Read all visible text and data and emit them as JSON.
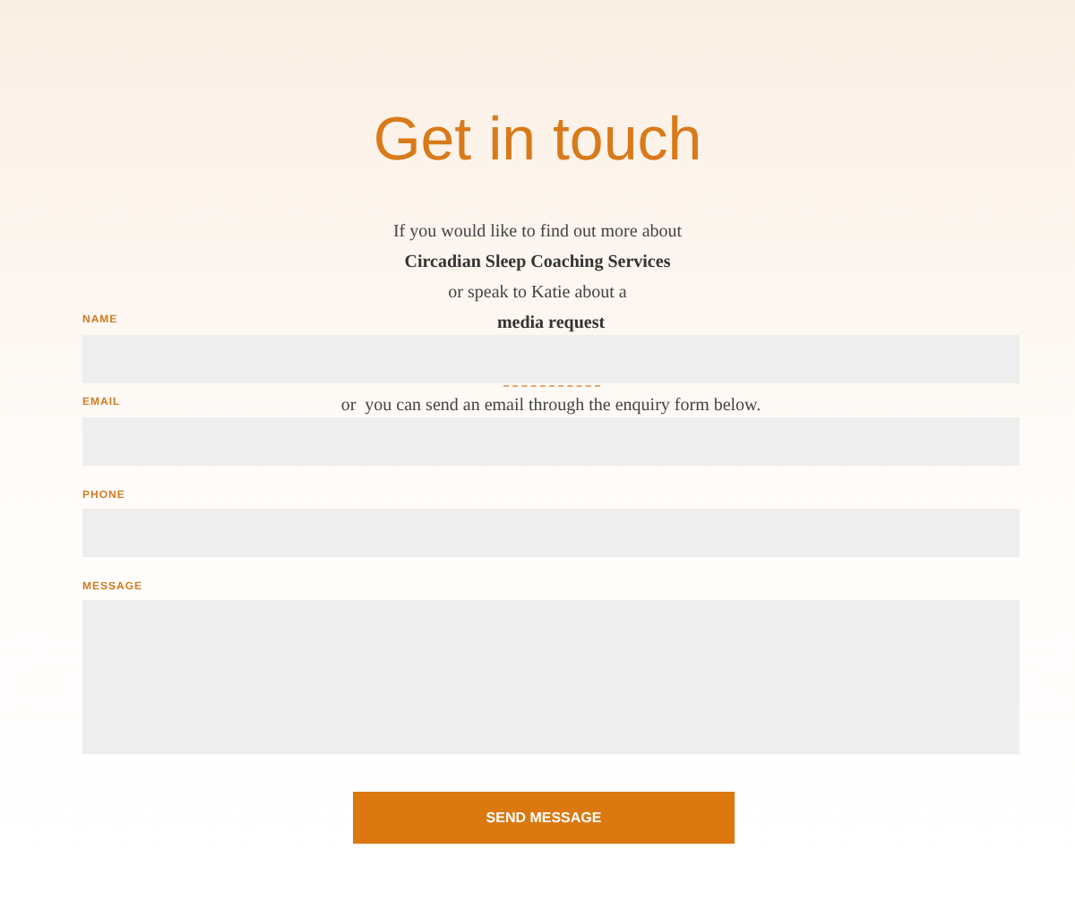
{
  "heading": "Get in touch",
  "intro": [
    {
      "text": "If you would like to find out more about",
      "bold": false
    },
    {
      "text": "Circadian Sleep Coaching Services",
      "bold": true
    },
    {
      "text": "or speak to Katie about a",
      "bold": false
    },
    {
      "text": "media request",
      "bold": true
    },
    {
      "text": "or  you can send an email through the enquiry form below.",
      "bold": false
    }
  ],
  "fields": [
    {
      "label": "NAME",
      "kind": "input"
    },
    {
      "label": "EMAIL",
      "kind": "input"
    },
    {
      "label": "PHONE",
      "kind": "input"
    },
    {
      "label": "MESSAGE",
      "kind": "textarea"
    }
  ],
  "button": "SEND MESSAGE"
}
